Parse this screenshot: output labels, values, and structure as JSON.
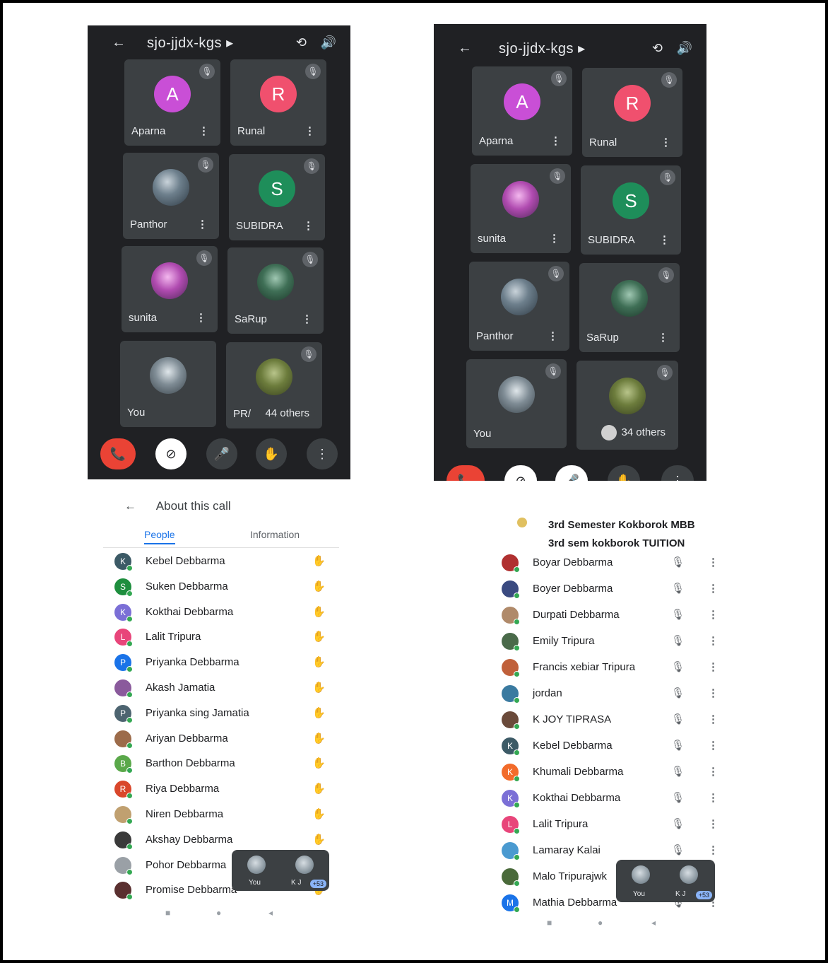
{
  "left_call": {
    "title": "sjo-jjdx-kgs ▸",
    "tiles": [
      {
        "initial": "A",
        "name": "Aparna",
        "color": "#c94fd6"
      },
      {
        "initial": "R",
        "name": "Runal",
        "color": "#f0506e"
      },
      {
        "initial": "",
        "name": "Panthor",
        "color": ""
      },
      {
        "initial": "S",
        "name": "SUBIDRA",
        "color": "#1e8e5a"
      },
      {
        "initial": "",
        "name": "sunita",
        "color": ""
      },
      {
        "initial": "",
        "name": "SaRup",
        "color": ""
      },
      {
        "initial": "",
        "name": "You",
        "color": ""
      },
      {
        "initial": "",
        "name": "PR/",
        "color": ""
      }
    ],
    "others": "44 others"
  },
  "right_call": {
    "title": "sjo-jjdx-kgs ▸",
    "tiles": [
      {
        "initial": "A",
        "name": "Aparna",
        "color": "#c94fd6"
      },
      {
        "initial": "R",
        "name": "Runal",
        "color": "#f0506e"
      },
      {
        "initial": "",
        "name": "sunita",
        "color": ""
      },
      {
        "initial": "S",
        "name": "SUBIDRA",
        "color": "#1e8e5a"
      },
      {
        "initial": "",
        "name": "Panthor",
        "color": ""
      },
      {
        "initial": "",
        "name": "SaRup",
        "color": ""
      },
      {
        "initial": "",
        "name": "You",
        "color": ""
      }
    ],
    "others": "34 others"
  },
  "left_panel": {
    "header": "About this call",
    "tab_people": "People",
    "tab_info": "Information",
    "people": [
      {
        "initial": "K",
        "name": "Kebel Debbarma",
        "color": "#3c5a66"
      },
      {
        "initial": "S",
        "name": "Suken Debbarma",
        "color": "#1e8e3e"
      },
      {
        "initial": "K",
        "name": "Kokthai Debbarma",
        "color": "#7b6fd6"
      },
      {
        "initial": "L",
        "name": "Lalit Tripura",
        "color": "#e8457a"
      },
      {
        "initial": "P",
        "name": "Priyanka Debbarma",
        "color": "#1a73e8"
      },
      {
        "initial": "",
        "name": "Akash Jamatia",
        "color": "#8a5a9c"
      },
      {
        "initial": "P",
        "name": "Priyanka sing Jamatia",
        "color": "#4d6470"
      },
      {
        "initial": "",
        "name": "Ariyan Debbarma",
        "color": "#9c6b4a"
      },
      {
        "initial": "B",
        "name": "Barthon Debbarma",
        "color": "#5aa84a"
      },
      {
        "initial": "R",
        "name": "Riya Debbarma",
        "color": "#d9472b"
      },
      {
        "initial": "",
        "name": "Niren Debbarma",
        "color": "#c0a070"
      },
      {
        "initial": "",
        "name": "Akshay Debbarma",
        "color": "#3a3a3a"
      },
      {
        "initial": "",
        "name": "Pohor Debbarma",
        "color": "#9aa0a6"
      },
      {
        "initial": "",
        "name": "Promise Debbarma",
        "color": "#5a3030"
      }
    ],
    "mini_you": "You",
    "mini_other": "K J",
    "mini_count": "+53"
  },
  "right_panel": {
    "groups": [
      "3rd Semester Kokborok MBB",
      "3rd sem kokborok TUITION"
    ],
    "people": [
      {
        "initial": "",
        "name": "Boyar Debbarma",
        "color": "#b03030"
      },
      {
        "initial": "",
        "name": "Boyer Debbarma",
        "color": "#3a4a80"
      },
      {
        "initial": "",
        "name": "Durpati Debbarma",
        "color": "#b08a6a"
      },
      {
        "initial": "",
        "name": "Emily Tripura",
        "color": "#4a6a4a"
      },
      {
        "initial": "",
        "name": "Francis xebiar Tripura",
        "color": "#c0603a"
      },
      {
        "initial": "",
        "name": "jordan",
        "color": "#3a7aa0"
      },
      {
        "initial": "",
        "name": "K JOY TIPRASA",
        "color": "#6a4a3a"
      },
      {
        "initial": "K",
        "name": "Kebel Debbarma",
        "color": "#3c5a66"
      },
      {
        "initial": "K",
        "name": "Khumali Debbarma",
        "color": "#f26b2a"
      },
      {
        "initial": "K",
        "name": "Kokthai Debbarma",
        "color": "#7b6fd6"
      },
      {
        "initial": "L",
        "name": "Lalit Tripura",
        "color": "#e8457a"
      },
      {
        "initial": "",
        "name": "Lamaray Kalai",
        "color": "#4a9ad0"
      },
      {
        "initial": "",
        "name": "Malo Tripurajwk",
        "color": "#4a6a3a"
      },
      {
        "initial": "M",
        "name": "Mathia Debbarma",
        "color": "#1a73e8"
      }
    ],
    "mini_you": "You",
    "mini_other": "K J",
    "mini_count": "+53"
  }
}
